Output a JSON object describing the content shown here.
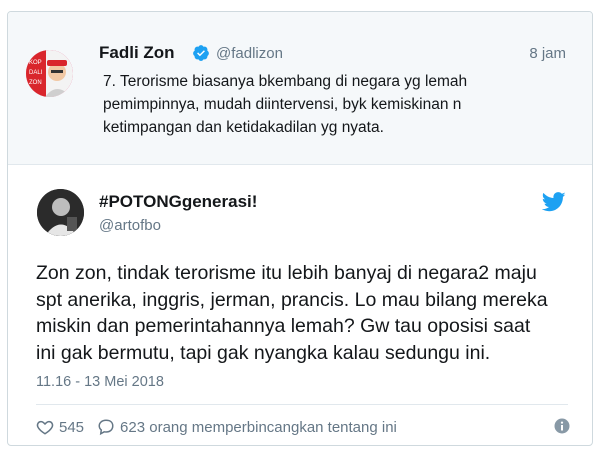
{
  "parent_tweet": {
    "name": "Fadli Zon",
    "handle": "@fadlizon",
    "time": "8 jam",
    "text_lines": [
      "7. Terorisme biasanya bkembang di negara yg lemah",
      "pemimpinnya, mudah diintervensi, byk kemiskinan n",
      "ketimpangan dan ketidakadilan yg nyata."
    ],
    "verified_icon": "verified-badge-icon"
  },
  "main_tweet": {
    "name": "#POTONGgenerasi!",
    "handle": "@artofbo",
    "text_lines": [
      "Zon zon, tindak terorisme itu lebih banyaj di negara2 maju",
      "spt anerika, inggris, jerman, prancis. Lo mau bilang mereka",
      "miskin dan pemerintahannya lemah? Gw tau oposisi saat",
      "ini gak bermutu, tapi gak nyangka kalau sedungu ini."
    ],
    "timestamp": "11.16 - 13 Mei 2018",
    "likes": "545",
    "replies_text": "623 orang memperbincangkan tentang ini"
  },
  "colors": {
    "twitter_blue": "#1da1f2",
    "muted": "#657786",
    "text": "#14171a"
  },
  "icons": [
    "verified-badge-icon",
    "twitter-bird-icon",
    "heart-icon",
    "speech-bubble-icon",
    "info-icon"
  ]
}
